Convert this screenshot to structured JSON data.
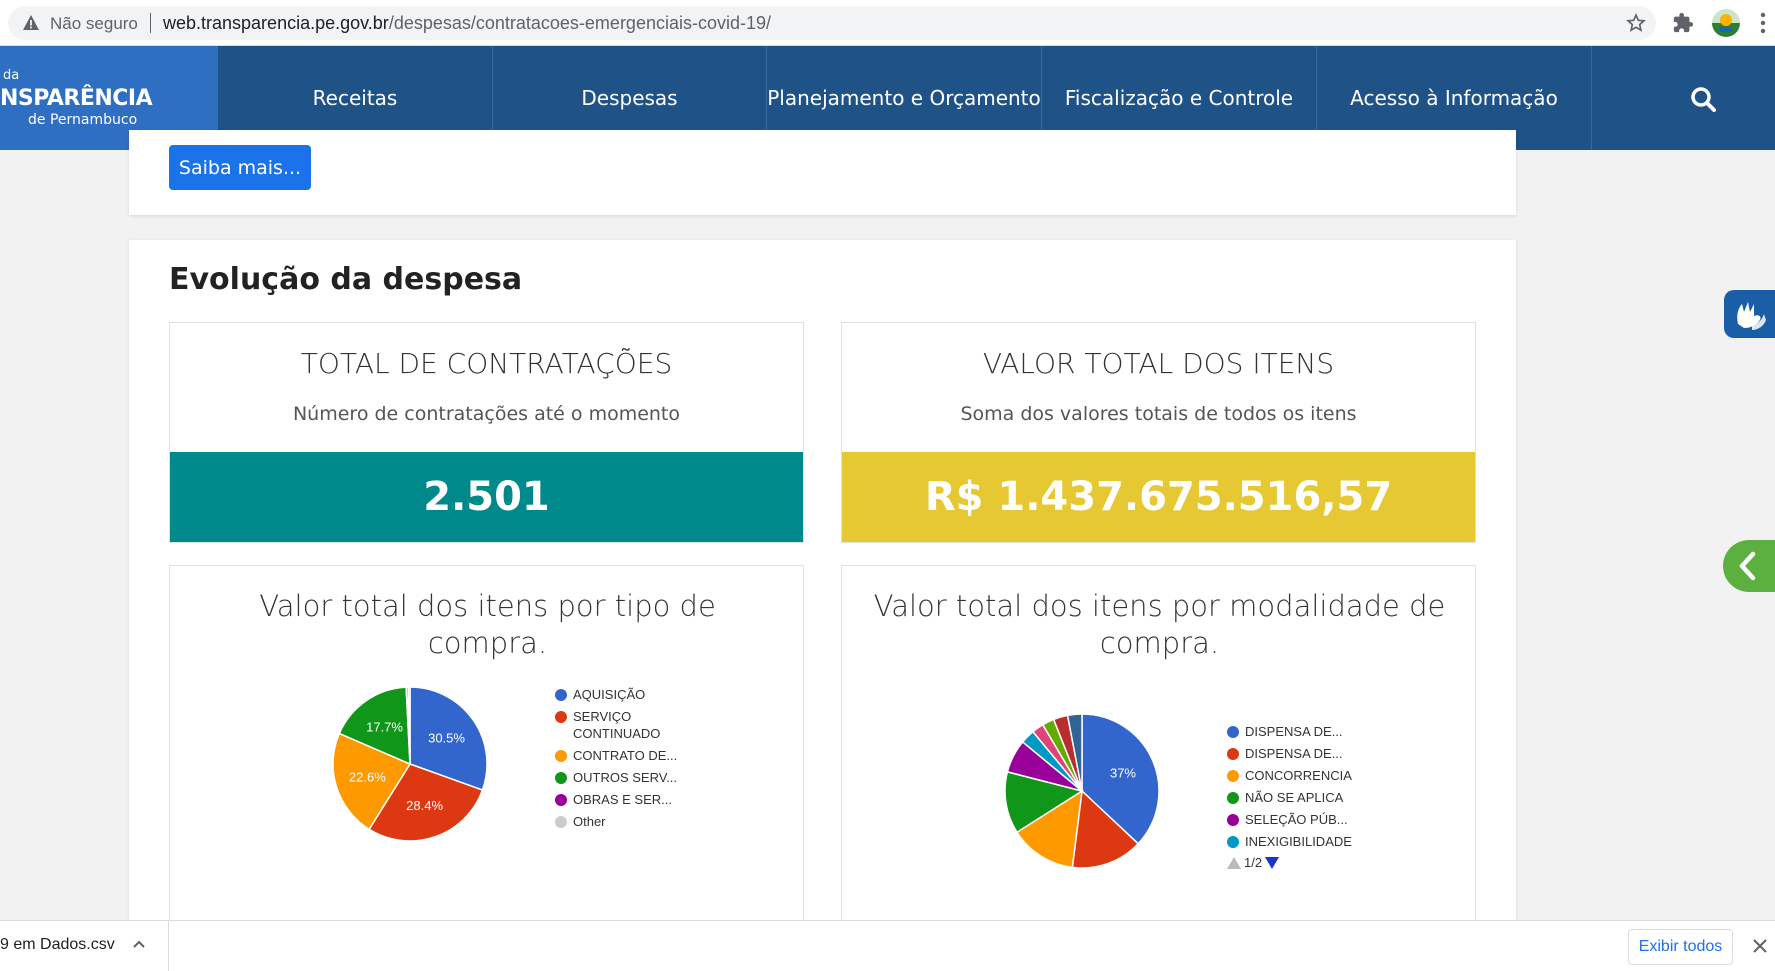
{
  "browser": {
    "security_label": "Não seguro",
    "url_host": "web.transparencia.pe.gov.br",
    "url_path": "/despesas/contratacoes-emergenciais-covid-19/"
  },
  "site": {
    "logo_line1": "da",
    "logo_line2": "NSPARÊNCIA",
    "logo_line3": "de Pernambuco",
    "nav": [
      "Receitas",
      "Despesas",
      "Planejamento e Orçamento",
      "Fiscalização e Controle",
      "Acesso à Informação"
    ]
  },
  "top_card": {
    "button_label": "Saiba mais..."
  },
  "section": {
    "title": "Evolução da despesa"
  },
  "kpis": [
    {
      "title": "TOTAL DE CONTRATAÇÕES",
      "subtitle": "Número de contratações até o momento",
      "value": "2.501",
      "color": "#00898a"
    },
    {
      "title": "VALOR TOTAL DOS ITENS",
      "subtitle": "Soma dos valores totais de todos os itens",
      "value": "R$ 1.437.675.516,57",
      "color": "#e6c832"
    }
  ],
  "chart_data": [
    {
      "type": "pie",
      "title": "Valor total dos itens por tipo de compra.",
      "categories": [
        "AQUISIÇÃO",
        "SERVIÇO CONTINUADO",
        "CONTRATO DE...",
        "OUTROS SERV...",
        "OBRAS E SER...",
        "Other"
      ],
      "values": [
        30.5,
        28.4,
        22.6,
        17.7,
        0.4,
        0.4
      ],
      "data_labels": [
        "30.5%",
        "28.4%",
        "22.6%",
        "17.7%",
        "",
        ""
      ],
      "colors": [
        "#3366cc",
        "#dc3912",
        "#ff9900",
        "#109618",
        "#990099",
        "#cccccc"
      ],
      "legend": "right"
    },
    {
      "type": "pie",
      "title": "Valor total dos itens por modalidade de compra.",
      "categories": [
        "DISPENSA DE...",
        "DISPENSA DE...",
        "CONCORRENCIA",
        "NÃO SE APLICA",
        "SELEÇÃO PÚB...",
        "INEXIGIBILIDADE",
        "",
        "",
        "",
        ""
      ],
      "values": [
        37,
        15,
        14,
        13,
        7,
        3,
        2.5,
        2.5,
        3,
        3
      ],
      "data_labels": [
        "37%",
        "",
        "",
        "",
        "",
        "",
        "",
        "",
        "",
        ""
      ],
      "colors": [
        "#3366cc",
        "#dc3912",
        "#ff9900",
        "#109618",
        "#990099",
        "#0099c6",
        "#dd4477",
        "#66aa00",
        "#b82e2e",
        "#316395"
      ],
      "legend": "right",
      "legend_visible_count": 6,
      "legend_page": "1/2"
    }
  ],
  "downloads": {
    "file_label": "9 em Dados.csv",
    "show_all_label": "Exibir todos"
  }
}
